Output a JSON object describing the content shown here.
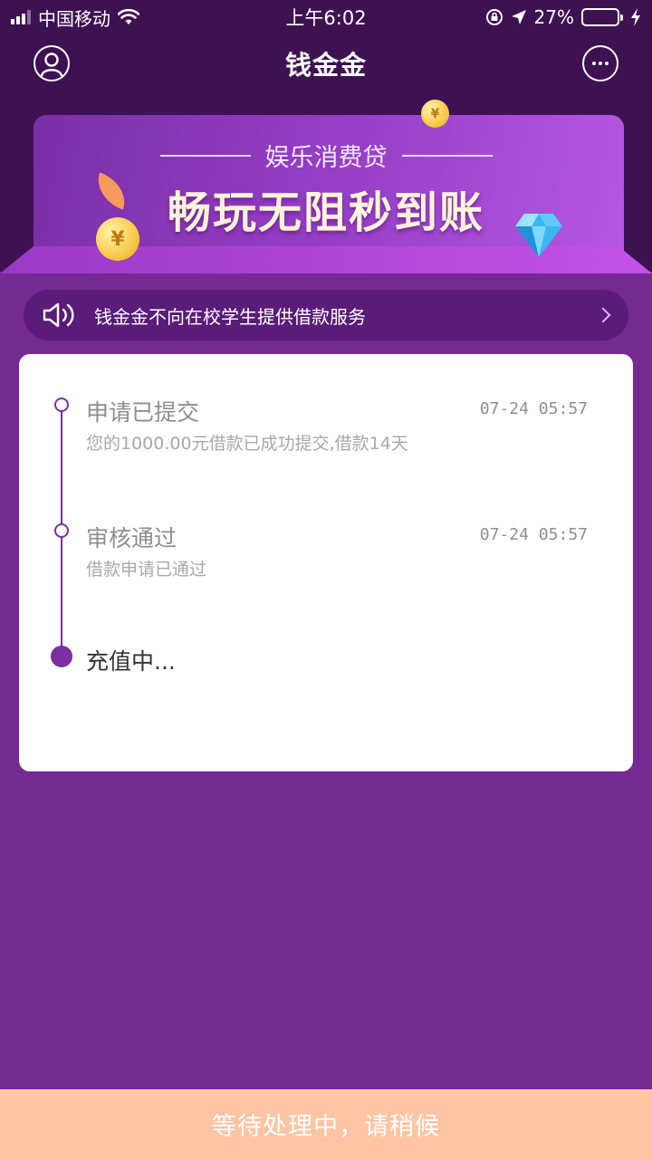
{
  "status_bar": {
    "carrier": "中国移动",
    "time": "上午6:02",
    "battery": "27%",
    "battery_level": 0.27
  },
  "nav": {
    "title": "钱金金"
  },
  "banner": {
    "subtitle": "娱乐消费贷",
    "headline": "畅玩无阻秒到账",
    "coin_symbol": "¥"
  },
  "notice": {
    "text": "钱金金不向在校学生提供借款服务"
  },
  "timeline": [
    {
      "title": "申请已提交",
      "time": "07-24 05:57",
      "desc": "您的1000.00元借款已成功提交,借款14天"
    },
    {
      "title": "审核通过",
      "time": "07-24 05:57",
      "desc": "借款申请已通过"
    },
    {
      "title": "充值中..."
    }
  ],
  "bottom_bar": {
    "label": "等待处理中，请稍候"
  },
  "colors": {
    "background": "#752993",
    "header": "#3e1252",
    "accent": "#7c2fa0",
    "bottom_bar": "#ffc4a3"
  }
}
